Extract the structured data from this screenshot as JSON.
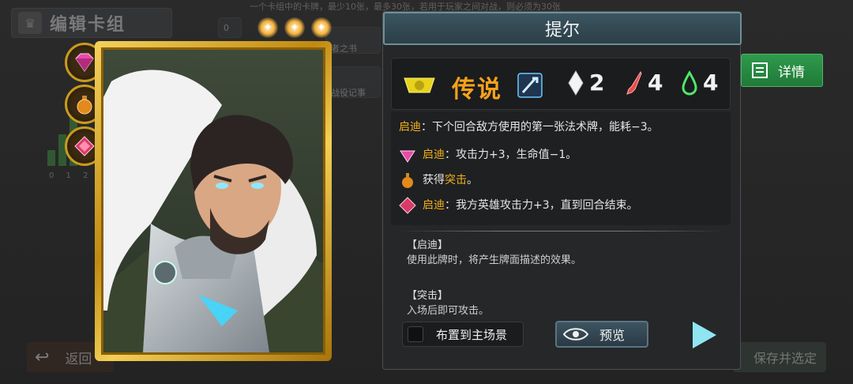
{
  "background": {
    "title": "编辑卡组",
    "hint": "一个卡组中的卡牌，最少10张，最多30张，若用于玩家之间对战，则必须为30张",
    "slots": [
      {
        "label": "0"
      },
      {
        "label": "者之书"
      },
      {
        "label": "战役记事"
      }
    ],
    "bar_labels": "0 1 2 3",
    "back_label": "返回",
    "save_label": "保存并选定"
  },
  "card": {
    "name": "提尔",
    "rarity": "传说",
    "cost": "2",
    "attack": "4",
    "health": "4",
    "star_count": 3
  },
  "description": {
    "main_keyword": "启迪",
    "main_text": "：下个回合敌方使用的第一张法术牌，能耗−3。",
    "options": [
      {
        "icon": "pink-gem-icon",
        "keyword": "启迪",
        "text": "：攻击力+3，生命值−1。"
      },
      {
        "icon": "potion-icon",
        "prefix": "获得",
        "keyword": "突击",
        "text": "。"
      },
      {
        "icon": "red-gem-icon",
        "keyword": "启迪",
        "text": "：我方英雄攻击力+3，直到回合结束。"
      }
    ]
  },
  "keywords": [
    {
      "head": "【启迪】",
      "body": "使用此牌时，将产生牌面描述的效果。"
    },
    {
      "head": "【突击】",
      "body": "入场后即可攻击。"
    }
  ],
  "buttons": {
    "place": "布置到主场景",
    "preview": "预览",
    "detail": "详情"
  },
  "colors": {
    "keyword": "#f2b11a",
    "rarity": "#f7a21a",
    "detail_button": "#2f9a4c",
    "card_frame": "#d9a92c"
  }
}
